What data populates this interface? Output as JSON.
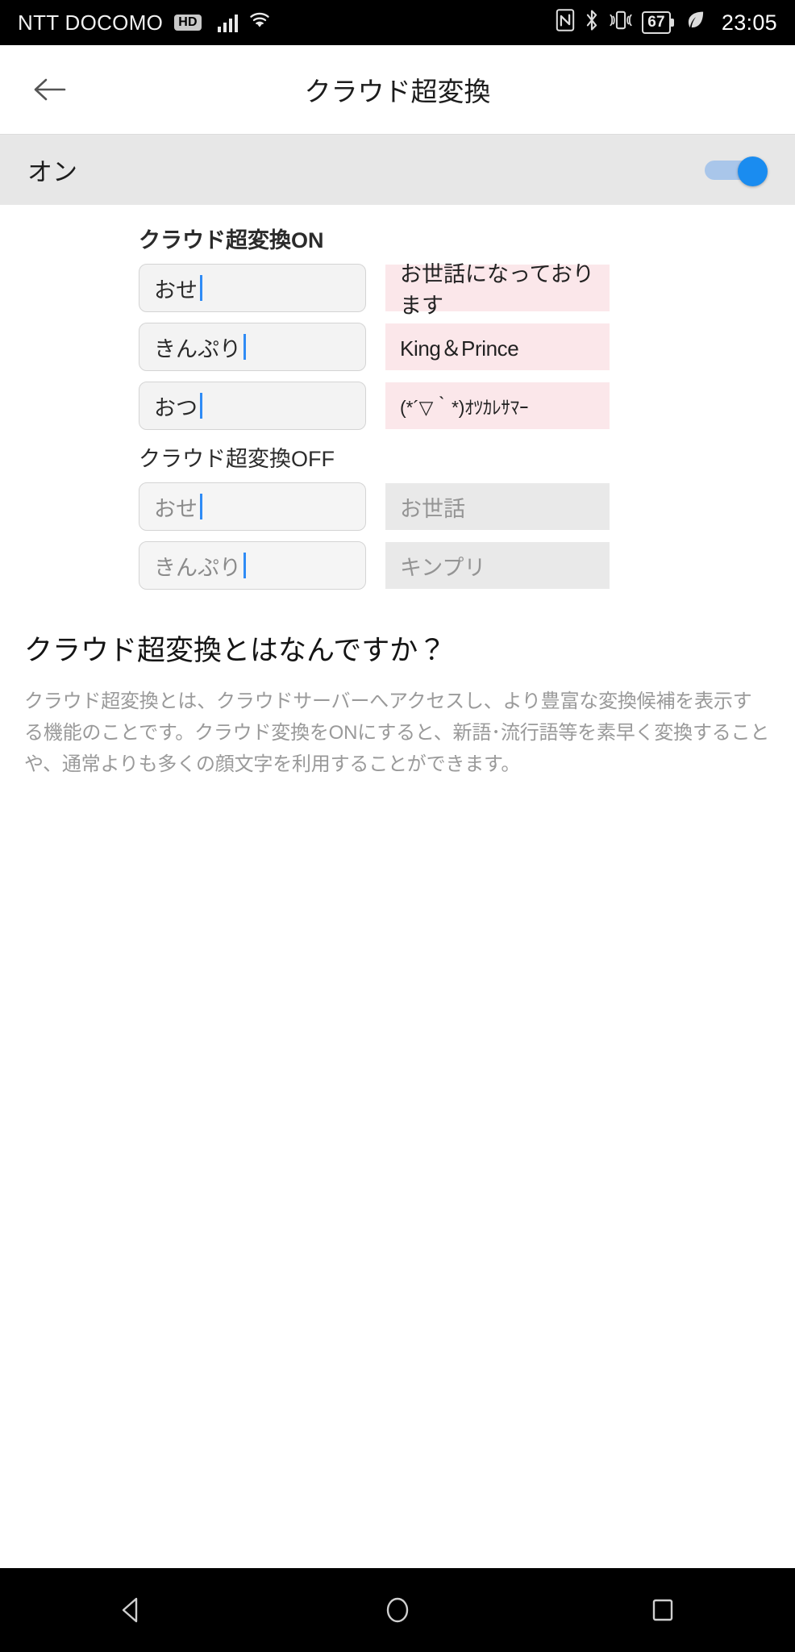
{
  "statusbar": {
    "carrier": "NTT DOCOMO",
    "hd_badge": "HD",
    "icons": [
      "signal-bars-icon",
      "wifi-icon",
      "nfc-icon",
      "bluetooth-icon",
      "vibrate-icon",
      "eco-leaf-icon"
    ],
    "battery_percent": "67",
    "time": "23:05"
  },
  "appbar": {
    "back_icon": "back-arrow-icon",
    "title": "クラウド超変換"
  },
  "toggle": {
    "label": "オン",
    "state": "on",
    "accent_color": "#1a8cf0",
    "track_color": "#a9c6ea",
    "row_bg": "#e7e7e7"
  },
  "examples": {
    "on": {
      "heading": "クラウド超変換ON",
      "result_bg": "#fbe7ea",
      "rows": [
        {
          "input": "おせ",
          "result": "お世話になっております"
        },
        {
          "input": "きんぷり",
          "result": "King＆Prince"
        },
        {
          "input": "おつ",
          "result": "(*´▽｀*)ｵﾂｶﾚｻﾏｰ"
        }
      ]
    },
    "off": {
      "heading": "クラウド超変換OFF",
      "result_bg": "#e9e9e9",
      "rows": [
        {
          "input": "おせ",
          "result": "お世話"
        },
        {
          "input": "きんぷり",
          "result": "キンプリ"
        }
      ]
    }
  },
  "faq": {
    "title": "クラウド超変換とはなんですか？",
    "body": "クラウド超変換とは、クラウドサーバーへアクセスし、より豊富な変換候補を表示する機能のことです。クラウド変換をONにすると、新語･流行語等を素早く変換することや、通常よりも多くの顔文字を利用することができます。"
  },
  "navbar": {
    "back": "nav-back-triangle-icon",
    "home": "nav-home-circle-icon",
    "recents": "nav-recents-square-icon"
  }
}
